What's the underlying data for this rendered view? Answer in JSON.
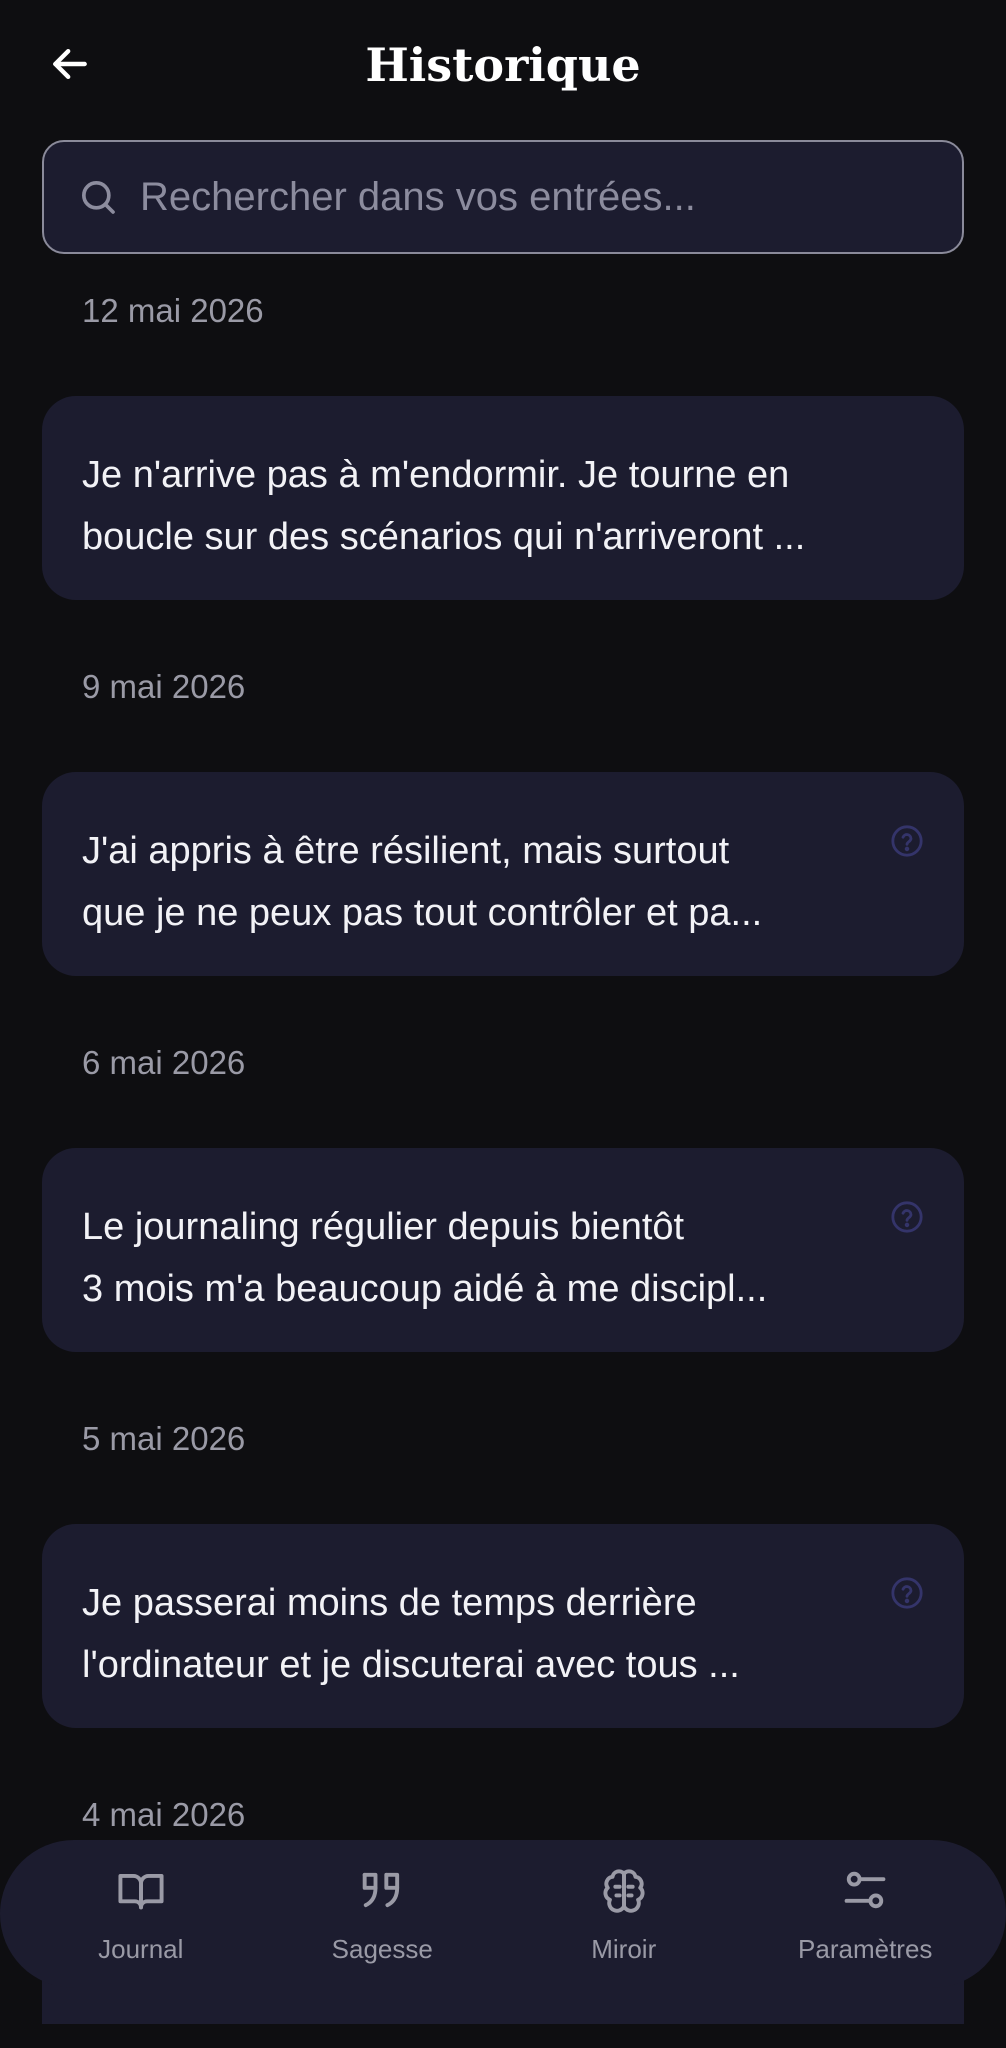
{
  "header": {
    "title": "Historique",
    "back_icon": "arrow-left-icon"
  },
  "search": {
    "placeholder": "Rechercher dans vos entrées...",
    "value": "",
    "icon": "search-icon"
  },
  "entries": [
    {
      "date": "12 mai 2026",
      "line1": "Je n'arrive pas à m'endormir. Je tourne en",
      "line2": "boucle sur des scénarios qui n'arriveront ...",
      "has_help_icon": false
    },
    {
      "date": "9 mai 2026",
      "line1": "J'ai appris à être résilient, mais surtout",
      "line2": "que je ne peux pas tout contrôler et pa...",
      "has_help_icon": true
    },
    {
      "date": "6 mai 2026",
      "line1": "Le journaling régulier depuis bientôt",
      "line2": "3 mois m'a beaucoup aidé à me discipl...",
      "has_help_icon": true
    },
    {
      "date": "5 mai 2026",
      "line1": "Je passerai moins de temps derrière",
      "line2": "l'ordinateur et je discuterai avec tous ...",
      "has_help_icon": true
    },
    {
      "date": "4 mai 2026"
    }
  ],
  "nav": {
    "items": [
      {
        "label": "Journal",
        "icon": "book-open-icon"
      },
      {
        "label": "Sagesse",
        "icon": "quote-icon"
      },
      {
        "label": "Miroir",
        "icon": "brain-icon"
      },
      {
        "label": "Paramètres",
        "icon": "settings-sliders-icon"
      }
    ]
  },
  "colors": {
    "background": "#0e0e11",
    "card": "#1c1c2f",
    "text": "#ffffff",
    "muted": "#9a9aa6",
    "help_icon": "#34346a"
  }
}
